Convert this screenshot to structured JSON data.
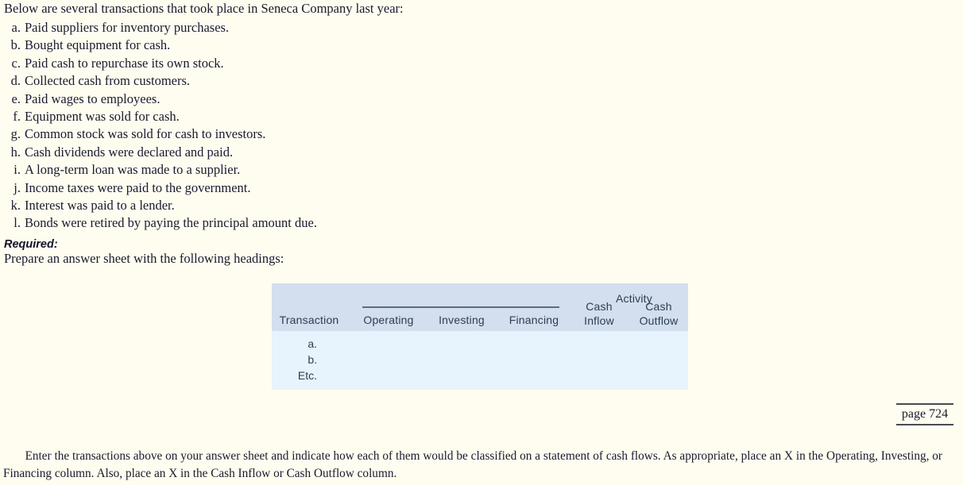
{
  "intro": "Below are several transactions that took place in Seneca Company last year:",
  "transactions": [
    {
      "letter": "a.",
      "text": "Paid suppliers for inventory purchases."
    },
    {
      "letter": "b.",
      "text": "Bought equipment for cash."
    },
    {
      "letter": "c.",
      "text": "Paid cash to repurchase its own stock."
    },
    {
      "letter": "d.",
      "text": "Collected cash from customers."
    },
    {
      "letter": "e.",
      "text": "Paid wages to employees."
    },
    {
      "letter": "f.",
      "text": "Equipment was sold for cash."
    },
    {
      "letter": "g.",
      "text": "Common stock was sold for cash to investors."
    },
    {
      "letter": "h.",
      "text": "Cash dividends were declared and paid."
    },
    {
      "letter": "i.",
      "text": "A long-term loan was made to a supplier."
    },
    {
      "letter": "j.",
      "text": "Income taxes were paid to the government."
    },
    {
      "letter": "k.",
      "text": "Interest was paid to a lender."
    },
    {
      "letter": "l.",
      "text": "Bonds were retired by paying the principal amount due."
    }
  ],
  "required": {
    "label": "Required:",
    "text": "Prepare an answer sheet with the following headings:"
  },
  "answer_sheet": {
    "group_header": "Activity",
    "columns": {
      "transaction": "Transaction",
      "operating": "Operating",
      "investing": "Investing",
      "financing": "Financing",
      "cash_inflow_line1": "Cash",
      "cash_inflow_line2": "Inflow",
      "cash_outflow_line1": "Cash",
      "cash_outflow_line2": "Outflow"
    },
    "rows": [
      "a.",
      "b.",
      "Etc."
    ],
    "colors": {
      "header_bg": "#d3deef",
      "body_bg": "#e7f3fd",
      "rule": "#5c6b80",
      "text": "#2c3e52"
    }
  },
  "page_number": "page 724",
  "closing": "Enter the transactions above on your answer sheet and indicate how each of them would be classified on a statement of cash flows. As appropriate, place an X in the Operating, Investing, or Financing column. Also, place an X in the Cash Inflow or Cash Outflow column."
}
